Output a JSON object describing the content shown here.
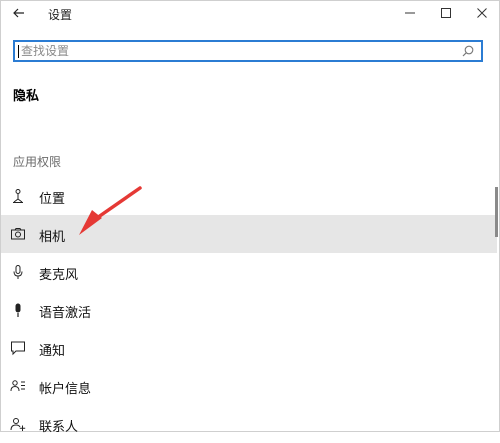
{
  "window": {
    "title": "设置"
  },
  "search": {
    "placeholder": "查找设置"
  },
  "page": {
    "title": "隐私",
    "section_label": "应用权限"
  },
  "nav": {
    "items": [
      {
        "label": "位置",
        "icon": "location-person-icon"
      },
      {
        "label": "相机",
        "icon": "camera-icon",
        "selected": true
      },
      {
        "label": "麦克风",
        "icon": "microphone-icon"
      },
      {
        "label": "语音激活",
        "icon": "voice-activation-icon"
      },
      {
        "label": "通知",
        "icon": "notification-icon"
      },
      {
        "label": "帐户信息",
        "icon": "account-info-icon"
      },
      {
        "label": "联系人",
        "icon": "contacts-icon"
      }
    ]
  },
  "colors": {
    "accent": "#2b7cd3",
    "selected_bg": "#e6e6e6",
    "arrow": "#e53935"
  }
}
